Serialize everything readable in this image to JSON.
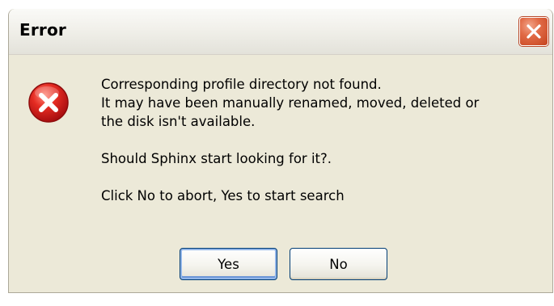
{
  "window": {
    "title": "Error",
    "close_icon": "close-x-icon",
    "close_color": "#d9532e"
  },
  "dialog": {
    "icon": "error-icon",
    "icon_color": "#d8171a",
    "message_lines": [
      "Corresponding profile directory not found.",
      "It may have been manually renamed, moved, deleted or",
      "the disk isn't available.",
      "Should Sphinx start looking for it?.",
      "Click No to abort, Yes to start search"
    ]
  },
  "buttons": {
    "yes_label": "Yes",
    "no_label": "No",
    "border_color": "#003c74"
  }
}
